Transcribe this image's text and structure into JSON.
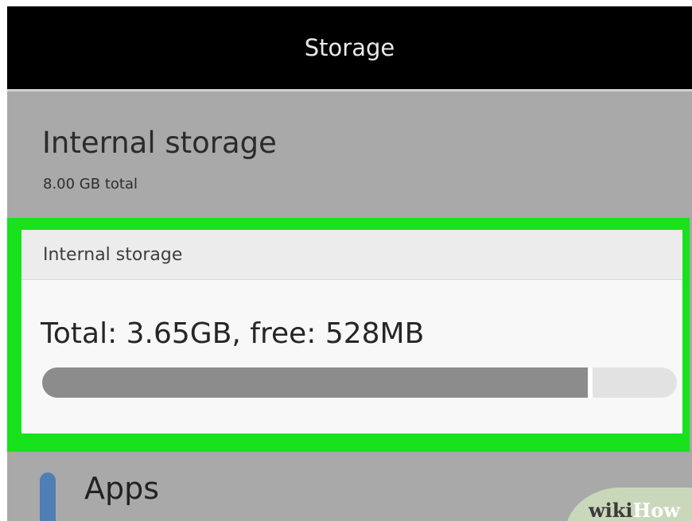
{
  "app_bar": {
    "title": "Storage"
  },
  "section": {
    "title": "Internal storage",
    "subtitle": "8.00 GB total"
  },
  "card": {
    "header": "Internal storage",
    "usage_text": "Total: 3.65GB, free: 528MB",
    "used_fraction": 0.86
  },
  "apps": {
    "label": "Apps"
  },
  "watermark": {
    "part1": "wiki",
    "part2": "How"
  },
  "colors": {
    "highlight": "#18e21c",
    "background": "#a9a9a9",
    "bar_fill": "#8c8c8c",
    "bar_track": "#e2e2e2",
    "apps_indicator": "#4f7fb5"
  }
}
